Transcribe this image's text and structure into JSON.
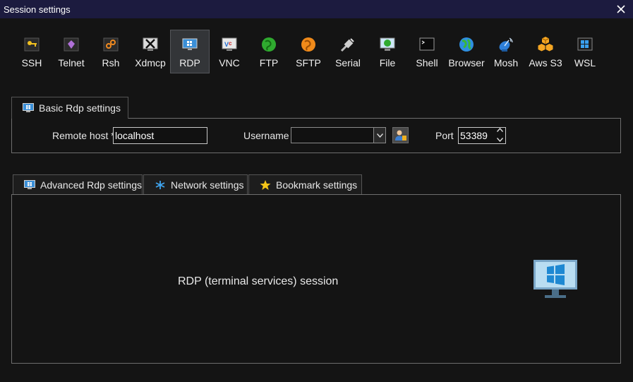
{
  "window": {
    "title": "Session settings",
    "close_icon": "close-icon"
  },
  "session_types": {
    "selected": "RDP",
    "items": [
      {
        "label": "SSH",
        "icon": "key-icon"
      },
      {
        "label": "Telnet",
        "icon": "telnet-icon"
      },
      {
        "label": "Rsh",
        "icon": "rsh-icon"
      },
      {
        "label": "Xdmcp",
        "icon": "x-icon"
      },
      {
        "label": "RDP",
        "icon": "monitor-icon"
      },
      {
        "label": "VNC",
        "icon": "vnc-icon"
      },
      {
        "label": "FTP",
        "icon": "ftp-globe-icon"
      },
      {
        "label": "SFTP",
        "icon": "sftp-globe-icon"
      },
      {
        "label": "Serial",
        "icon": "serial-plug-icon"
      },
      {
        "label": "File",
        "icon": "file-monitor-icon"
      },
      {
        "label": "Shell",
        "icon": "terminal-icon"
      },
      {
        "label": "Browser",
        "icon": "globe-icon"
      },
      {
        "label": "Mosh",
        "icon": "satellite-dish-icon"
      },
      {
        "label": "Aws S3",
        "icon": "aws-boxes-icon"
      },
      {
        "label": "WSL",
        "icon": "windows-icon"
      }
    ]
  },
  "basic": {
    "tab_label": "Basic Rdp settings",
    "remote_host_label": "Remote host *",
    "remote_host_value": "localhost",
    "username_label": "Username",
    "username_value": "",
    "port_label": "Port",
    "port_value": "53389"
  },
  "advanced_tabs": [
    {
      "label": "Advanced Rdp settings",
      "icon": "monitor-icon"
    },
    {
      "label": "Network settings",
      "icon": "network-icon"
    },
    {
      "label": "Bookmark settings",
      "icon": "star-icon"
    }
  ],
  "description": "RDP (terminal services) session",
  "colors": {
    "titlebar": "#1c1b3f",
    "background": "#141414",
    "selected_type": "#333538",
    "accent_blue": "#1e88d2"
  }
}
